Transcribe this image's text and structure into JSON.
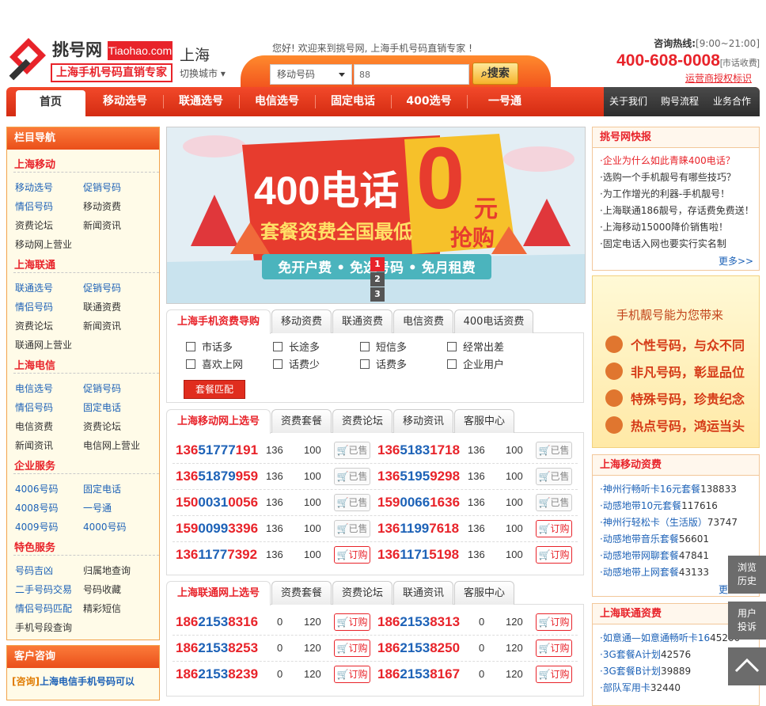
{
  "header": {
    "logo_cn": "挑号网",
    "logo_en": "Tiaohao.com",
    "logo_tagline": "上海手机号码直销专家",
    "city": "上海",
    "switch_city": "切换城市",
    "welcome": "您好! 欢迎来到挑号网, 上海手机号码直销专家 !",
    "hotline_label": "咨询热线:",
    "hotline_hours": "[9:00~21:00]",
    "hotline_number": "400-608-0008",
    "hotline_note": "[市话收费]",
    "authorized": "运营商授权标识"
  },
  "search": {
    "select": "移动号码",
    "value": "88",
    "button": "搜索"
  },
  "nav": {
    "items": [
      "首页",
      "移动选号",
      "联通选号",
      "电信选号",
      "固定电话",
      "400选号",
      "一号通"
    ],
    "right": [
      "关于我们",
      "购号流程",
      "业务合作"
    ]
  },
  "left": {
    "title": "栏目导航",
    "sections": [
      {
        "name": "上海移动",
        "links": [
          "移动选号",
          "促销号码",
          "情侣号码",
          "移动资费",
          "资费论坛",
          "新闻资讯",
          "移动网上营业"
        ]
      },
      {
        "name": "上海联通",
        "links": [
          "联通选号",
          "促销号码",
          "情侣号码",
          "联通资费",
          "资费论坛",
          "新闻资讯",
          "联通网上营业"
        ]
      },
      {
        "name": "上海电信",
        "links": [
          "电信选号",
          "促销号码",
          "情侣号码",
          "固定电话",
          "电信资费",
          "资费论坛",
          "新闻资讯",
          "电信网上营业"
        ]
      },
      {
        "name": "企业服务",
        "links": [
          "4006号码",
          "固定电话",
          "4008号码",
          "一号通",
          "4009号码",
          "4000号码"
        ]
      },
      {
        "name": "特色服务",
        "links": [
          "号码吉凶",
          "归属地查询",
          "二手号码交易",
          "号码收藏",
          "情侣号码匹配",
          "精彩短信",
          "手机号段查询"
        ]
      }
    ],
    "consult_title": "客户咨询",
    "consult_text1": "[咨询]",
    "consult_text2": "上海电信手机号码可以"
  },
  "banner": {
    "line1": "400电话",
    "zero": "0",
    "yuan": "元",
    "line2": "套餐资费全国最低",
    "grab": "抢购",
    "ribbon": "免开户费 • 免选号码 • 免月租费",
    "dots": [
      "1",
      "2",
      "3"
    ]
  },
  "fee_tabs": {
    "tabs": [
      "上海手机资费导购",
      "移动资费",
      "联通资费",
      "电信资费",
      "400电话资费"
    ],
    "options": [
      "市话多",
      "长途多",
      "短信多",
      "经常出差",
      "喜欢上网",
      "话费少",
      "话费多",
      "企业用户"
    ],
    "button": "套餐匹配"
  },
  "mobile": {
    "tabs": [
      "上海移动网上选号",
      "资费套餐",
      "资费论坛",
      "移动资讯",
      "客服中心"
    ],
    "rows": [
      [
        {
          "a": "136",
          "b": "51777",
          "c": "191",
          "pre": "136",
          "price": "100",
          "status": "已售"
        },
        {
          "a": "136",
          "b": "5183",
          "c": "1718",
          "pre": "136",
          "price": "100",
          "status": "已售"
        }
      ],
      [
        {
          "a": "136",
          "b": "51879",
          "c": "959",
          "pre": "136",
          "price": "100",
          "status": "已售"
        },
        {
          "a": "136",
          "b": "5195",
          "c": "9298",
          "pre": "136",
          "price": "100",
          "status": "已售"
        }
      ],
      [
        {
          "a": "150",
          "b": "0031",
          "c": "0056",
          "pre": "136",
          "price": "100",
          "status": "已售"
        },
        {
          "a": "159",
          "b": "0066",
          "c": "1636",
          "pre": "136",
          "price": "100",
          "status": "已售"
        }
      ],
      [
        {
          "a": "159",
          "b": "0099",
          "c": "3396",
          "pre": "136",
          "price": "100",
          "status": "已售"
        },
        {
          "a": "136",
          "b": "1199",
          "c": "7618",
          "pre": "136",
          "price": "100",
          "status": "订购"
        }
      ],
      [
        {
          "a": "136",
          "b": "1177",
          "c": "7392",
          "pre": "136",
          "price": "100",
          "status": "订购"
        },
        {
          "a": "136",
          "b": "1171",
          "c": "5198",
          "pre": "136",
          "price": "100",
          "status": "订购"
        }
      ]
    ]
  },
  "unicom": {
    "tabs": [
      "上海联通网上选号",
      "资费套餐",
      "资费论坛",
      "联通资讯",
      "客服中心"
    ],
    "rows": [
      [
        {
          "a": "186",
          "b": "2153",
          "c": "8316",
          "pre": "0",
          "price": "120",
          "status": "订购"
        },
        {
          "a": "186",
          "b": "2153",
          "c": "8313",
          "pre": "0",
          "price": "120",
          "status": "订购"
        }
      ],
      [
        {
          "a": "186",
          "b": "2153",
          "c": "8253",
          "pre": "0",
          "price": "120",
          "status": "订购"
        },
        {
          "a": "186",
          "b": "2153",
          "c": "8250",
          "pre": "0",
          "price": "120",
          "status": "订购"
        }
      ],
      [
        {
          "a": "186",
          "b": "2153",
          "c": "8239",
          "pre": "0",
          "price": "120",
          "status": "订购"
        },
        {
          "a": "186",
          "b": "2153",
          "c": "8167",
          "pre": "0",
          "price": "120",
          "status": "订购"
        }
      ]
    ]
  },
  "news": {
    "title": "挑号网快报",
    "items": [
      "·企业为什么如此青睐400电话？",
      "·选购一个手机靓号有哪些技巧？",
      "·为工作增光的利器-手机靓号！",
      "·上海联通186靓号，存话费免费送！",
      "·上海移动15000降价销售啦！",
      "·固定电话入网也要实行实名制"
    ],
    "more": "更多>>"
  },
  "promo": {
    "title": "手机靓号能为您带来",
    "items": [
      "个性号码，与众不同",
      "非凡号码，彰显品位",
      "特殊号码，珍贵纪念",
      "热点号码，鸿运当头"
    ]
  },
  "mobile_fee": {
    "title": "上海移动资费",
    "items": [
      {
        "name": "·神州行畅听卡16元套餐",
        "count": "138833"
      },
      {
        "name": "·动感地带10元套餐",
        "count": "117616"
      },
      {
        "name": "·神州行轻松卡（生活版）",
        "count": "73747"
      },
      {
        "name": "·动感地带音乐套餐",
        "count": "56601"
      },
      {
        "name": "·动感地带网聊套餐",
        "count": "47841"
      },
      {
        "name": "·动感地带上网套餐",
        "count": "43133"
      }
    ],
    "more": "更"
  },
  "unicom_fee": {
    "title": "上海联通资费",
    "items": [
      {
        "name": "·如意通—如意通畅听卡16",
        "count": "45200"
      },
      {
        "name": "·3G套餐A计划",
        "count": "42576"
      },
      {
        "name": "·3G套餐B计划",
        "count": "39889"
      },
      {
        "name": "·部队军用卡",
        "count": "32440"
      }
    ]
  },
  "float": {
    "history": "浏览历史",
    "history1": "浏览",
    "history2": "历史",
    "complain1": "用户",
    "complain2": "投诉"
  }
}
